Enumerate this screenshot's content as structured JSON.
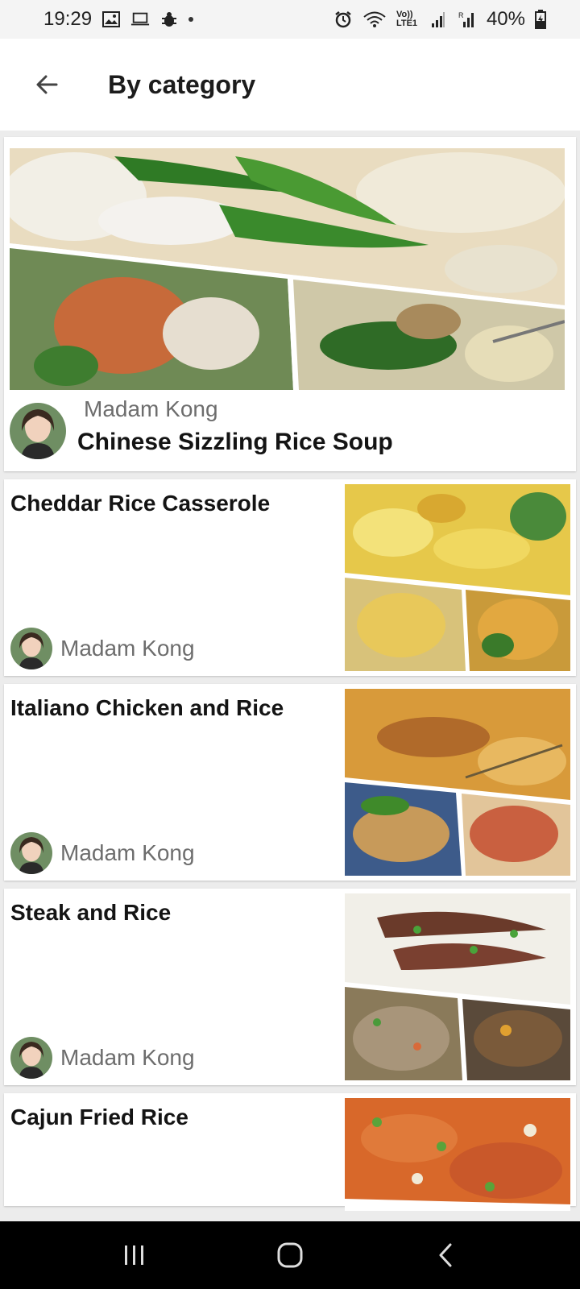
{
  "status_bar": {
    "time": "19:29",
    "battery": "40%",
    "network_label": "Vo)) LTE1",
    "icons": [
      "gallery-icon",
      "laptop-icon",
      "bug-icon",
      "alarm-icon",
      "wifi-icon",
      "signal-icon",
      "signal-roaming-icon",
      "battery-charging-icon"
    ]
  },
  "app_bar": {
    "back_icon": "arrow-left-icon",
    "title": "By category"
  },
  "featured": {
    "author": "Madam Kong",
    "title": "Chinese Sizzling Rice Soup"
  },
  "recipes": [
    {
      "title": "Cheddar Rice Casserole",
      "author": "Madam Kong"
    },
    {
      "title": "Italiano Chicken and Rice",
      "author": "Madam Kong"
    },
    {
      "title": "Steak and Rice",
      "author": "Madam Kong"
    },
    {
      "title": "Cajun Fried Rice",
      "author": ""
    }
  ],
  "nav_bar": {
    "recents_icon": "recents-icon",
    "home_icon": "home-icon",
    "back_icon": "nav-back-icon"
  },
  "colors": {
    "status_bar_bg": "#f4f4f4",
    "app_bar_bg": "#ffffff",
    "list_bg": "#ececec",
    "card_bg": "#ffffff",
    "author_text": "#6d6d6d",
    "nav_bar_bg": "#000000"
  }
}
